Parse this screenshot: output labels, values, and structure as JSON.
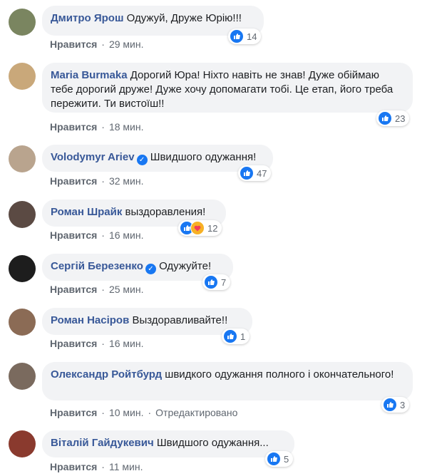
{
  "like_label": "Нравится",
  "comments": [
    {
      "author": "Дмитро Ярош",
      "verified": false,
      "text": "Одужуй, Друже Юрію!!!",
      "time": "29 мин.",
      "edited": "",
      "reactions": [
        "like"
      ],
      "count": "14",
      "avatar_color": "#7a8560"
    },
    {
      "author": "Maria Burmaka",
      "verified": false,
      "text": "Дорогий Юра! Ніхто навіть не знав! Дуже обіймаю тебе дорогий друже! Дуже хочу допомагати тобі. Це етап, його треба пережити. Ти вистоїш!!",
      "time": "18 мин.",
      "edited": "",
      "reactions": [
        "like"
      ],
      "count": "23",
      "avatar_color": "#c9a87a"
    },
    {
      "author": "Volodymyr Ariev",
      "verified": true,
      "text": "Швидшого одужання!",
      "time": "32 мин.",
      "edited": "",
      "reactions": [
        "like"
      ],
      "count": "47",
      "avatar_color": "#b9a48e"
    },
    {
      "author": "Роман Шрайк",
      "verified": false,
      "text": "выздоравления!",
      "time": "16 мин.",
      "edited": "",
      "reactions": [
        "like",
        "care"
      ],
      "count": "12",
      "avatar_color": "#5b4a43"
    },
    {
      "author": "Сергій Березенко",
      "verified": true,
      "text": "Одужуйте!",
      "time": "25 мин.",
      "edited": "",
      "reactions": [
        "like"
      ],
      "count": "7",
      "avatar_color": "#1d1d1d"
    },
    {
      "author": "Роман Насіров",
      "verified": false,
      "text": "Выздоравливайте!!",
      "time": "16 мин.",
      "edited": "",
      "reactions": [
        "like"
      ],
      "count": "1",
      "avatar_color": "#8b6b55"
    },
    {
      "author": "Олександр Ройтбурд",
      "verified": false,
      "text": "швидкого одужання полного і окончательного!",
      "time": "10 мин.",
      "edited": "Отредактировано",
      "reactions": [
        "like"
      ],
      "count": "3",
      "avatar_color": "#7a6a5e"
    },
    {
      "author": "Віталій Гайдукевич",
      "verified": false,
      "text": "Швидшого одужання...",
      "time": "11 мин.",
      "edited": "",
      "reactions": [
        "like"
      ],
      "count": "5",
      "avatar_color": "#8a3a2e"
    }
  ]
}
